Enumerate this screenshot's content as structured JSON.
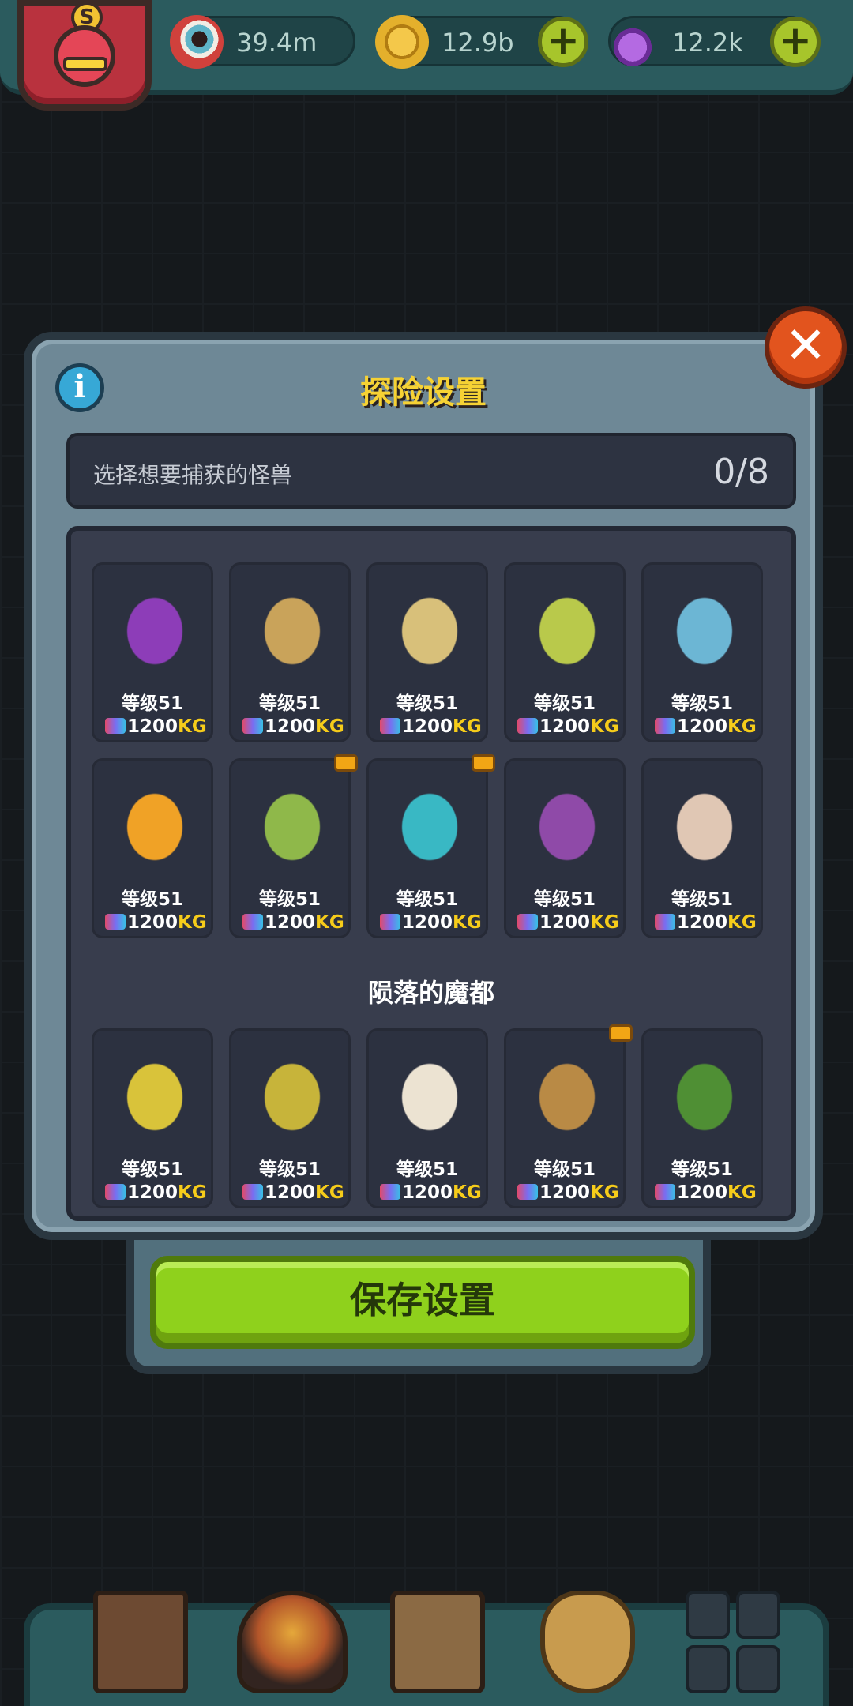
{
  "resources": [
    {
      "id": "eyes",
      "value": "39.4m",
      "icon": "eyeball-icon",
      "color": "#d0413c",
      "has_plus": false
    },
    {
      "id": "coins",
      "value": "12.9b",
      "icon": "coin-icon",
      "color": "#d9a51e",
      "has_plus": true
    },
    {
      "id": "potion",
      "value": "12.2k",
      "icon": "potion-icon",
      "color": "#8e46c8",
      "has_plus": true
    }
  ],
  "player_badge": "S",
  "dialog": {
    "title": "探险设置",
    "info_glyph": "i",
    "close_glyph": "✕",
    "counter_label": "选择想要捕获的怪兽",
    "counter_value": "0/8",
    "section_title": "陨落的魔都",
    "save_label": "保存设置"
  },
  "monsters_group1": [
    {
      "level": "等级51",
      "weight": "1200",
      "unit": "KG",
      "color": "#8d3db8",
      "crown": false
    },
    {
      "level": "等级51",
      "weight": "1200",
      "unit": "KG",
      "color": "#c9a35a",
      "crown": false
    },
    {
      "level": "等级51",
      "weight": "1200",
      "unit": "KG",
      "color": "#d8c07a",
      "crown": false
    },
    {
      "level": "等级51",
      "weight": "1200",
      "unit": "KG",
      "color": "#b9c94b",
      "crown": false
    },
    {
      "level": "等级51",
      "weight": "1200",
      "unit": "KG",
      "color": "#6cb6d4",
      "crown": false
    },
    {
      "level": "等级51",
      "weight": "1200",
      "unit": "KG",
      "color": "#f0a226",
      "crown": false
    },
    {
      "level": "等级51",
      "weight": "1200",
      "unit": "KG",
      "color": "#8fb84a",
      "crown": true
    },
    {
      "level": "等级51",
      "weight": "1200",
      "unit": "KG",
      "color": "#39b8c4",
      "crown": true
    },
    {
      "level": "等级51",
      "weight": "1200",
      "unit": "KG",
      "color": "#8f4aa8",
      "crown": false
    },
    {
      "level": "等级51",
      "weight": "1200",
      "unit": "KG",
      "color": "#e0c7b4",
      "crown": false
    }
  ],
  "monsters_group2": [
    {
      "level": "等级51",
      "weight": "1200",
      "unit": "KG",
      "color": "#d9c33a",
      "crown": false
    },
    {
      "level": "等级51",
      "weight": "1200",
      "unit": "KG",
      "color": "#c7b43a",
      "crown": false
    },
    {
      "level": "等级51",
      "weight": "1200",
      "unit": "KG",
      "color": "#ece3d2",
      "crown": false
    },
    {
      "level": "等级51",
      "weight": "1200",
      "unit": "KG",
      "color": "#b98a45",
      "crown": true
    },
    {
      "level": "等级51",
      "weight": "1200",
      "unit": "KG",
      "color": "#4f8f34",
      "crown": false
    }
  ],
  "nav": [
    {
      "id": "shop",
      "icon": "shop-building-icon"
    },
    {
      "id": "lair",
      "icon": "monster-lair-icon"
    },
    {
      "id": "book",
      "icon": "book-icon"
    },
    {
      "id": "bag",
      "icon": "loot-bag-icon"
    },
    {
      "id": "monsters",
      "icon": "monster-grid-icon"
    }
  ]
}
